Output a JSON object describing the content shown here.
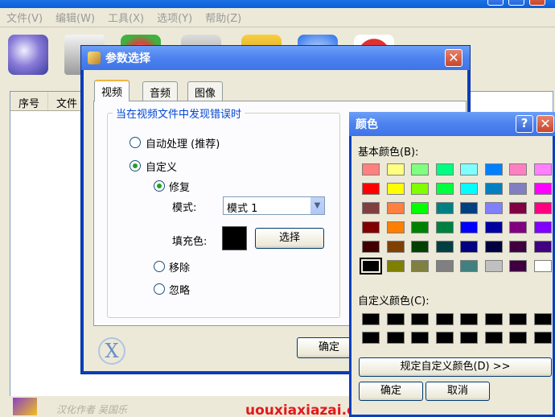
{
  "main": {
    "menu": [
      "文件(V)",
      "编辑(W)",
      "工具(X)",
      "选项(Y)",
      "帮助(Z)"
    ],
    "list_headers": [
      "序号",
      "文件"
    ],
    "credit": "汉化作者 吴国乐",
    "watermark": "uouxiaxiazai.com"
  },
  "param_dialog": {
    "title": "参数选择",
    "close": "✕",
    "tabs": [
      "视频",
      "音频",
      "图像"
    ],
    "active_tab": "视频",
    "group_title": "当在视频文件中发现错误时",
    "auto": "自动处理 (推荐)",
    "custom": "自定义",
    "repair": "修复",
    "mode_label": "模式:",
    "mode_value": "模式 1",
    "fill_label": "填充色:",
    "select_button": "选择",
    "remove": "移除",
    "ignore": "忽略",
    "ok_button": "确定",
    "logo": "X"
  },
  "color_dialog": {
    "title": "颜色",
    "help": "?",
    "close": "✕",
    "basic_label": "基本颜色(B):",
    "custom_label": "自定义颜色(C):",
    "define_button": "规定自定义颜色(D) >>",
    "ok_button": "确定",
    "cancel_button": "取消",
    "basic_colors": [
      [
        "#ff8080",
        "#ffff80",
        "#80ff80",
        "#00ff80",
        "#80ffff",
        "#0080ff",
        "#ff80c0",
        "#ff80ff"
      ],
      [
        "#ff0000",
        "#ffff00",
        "#80ff00",
        "#00ff40",
        "#00ffff",
        "#0080c0",
        "#8080c0",
        "#ff00ff"
      ],
      [
        "#804040",
        "#ff8040",
        "#00ff00",
        "#008080",
        "#004080",
        "#8080ff",
        "#800040",
        "#ff0080"
      ],
      [
        "#800000",
        "#ff8000",
        "#008000",
        "#008040",
        "#0000ff",
        "#0000a0",
        "#800080",
        "#8000ff"
      ],
      [
        "#400000",
        "#804000",
        "#004000",
        "#004040",
        "#000080",
        "#000040",
        "#400040",
        "#400080"
      ],
      [
        "#000000",
        "#808000",
        "#808040",
        "#808080",
        "#408080",
        "#c0c0c0",
        "#400040",
        "#ffffff"
      ]
    ],
    "selected": "#000000"
  }
}
